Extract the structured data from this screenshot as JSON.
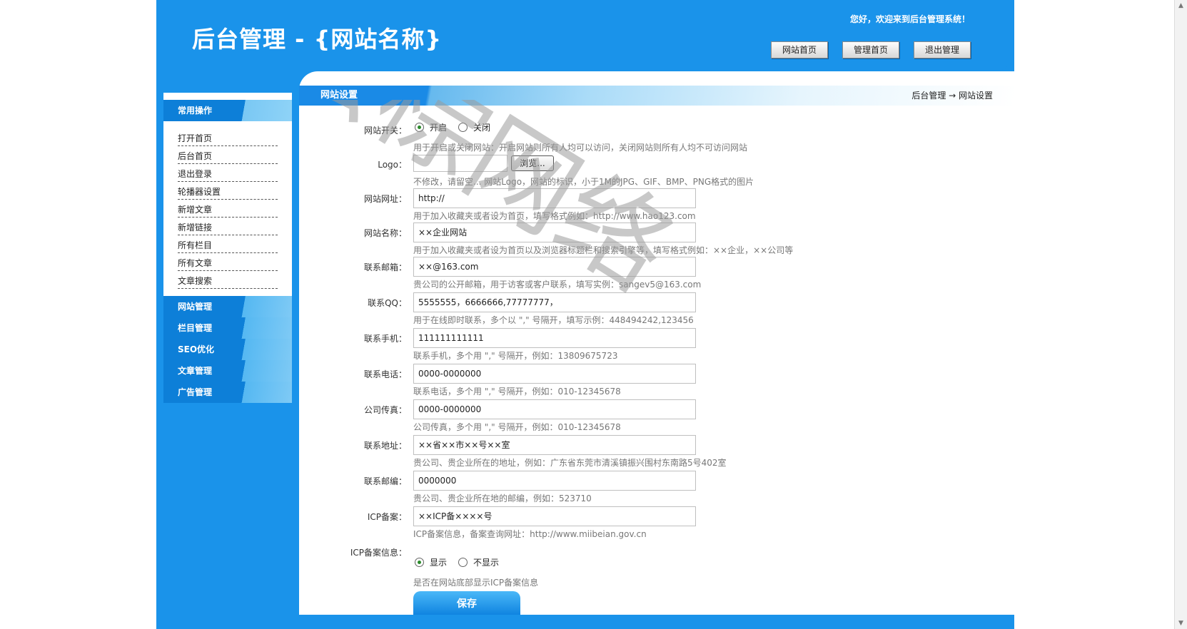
{
  "header": {
    "site_title": "后台管理 - {网站名称}",
    "welcome": "您好，欢迎来到后台管理系统！",
    "buttons": {
      "home": "网站首页",
      "admin": "管理首页",
      "logout": "退出管理"
    }
  },
  "sidebar": {
    "common_title": "常用操作",
    "items": [
      "打开首页",
      "后台首页",
      "退出登录",
      "轮播器设置",
      "新增文章",
      "新增链接",
      "所有栏目",
      "所有文章",
      "文章搜索"
    ],
    "categories": [
      "网站管理",
      "栏目管理",
      "SEO优化",
      "文章管理",
      "广告管理"
    ]
  },
  "content": {
    "title": "网站设置",
    "breadcrumb": "后台管理 → 网站设置"
  },
  "form": {
    "site_switch": {
      "label": "网站开关：",
      "options": [
        "开启",
        "关闭"
      ],
      "selected": "开启",
      "hint": "用于开启或关闭网站：开启网站则所有人均可以访问，关闭网站则所有人均不可访问网站"
    },
    "logo": {
      "label": "Logo：",
      "browse": "浏览...",
      "hint": "不修改，请留空...  网站Logo，网站的标识，小于1M的JPG、GIF、BMP、PNG格式的图片"
    },
    "site_url": {
      "label": "网站网址：",
      "value": "http://",
      "hint": "用于加入收藏夹或者设为首页，填写格式例如：http://www.hao123.com"
    },
    "site_name": {
      "label": "网站名称：",
      "value": "××企业网站",
      "hint": "用于加入收藏夹或者设为首页以及浏览器标题栏和搜索引擎等，填写格式例如：××企业，××公司等"
    },
    "email": {
      "label": "联系邮箱：",
      "value": "××@163.com",
      "hint": "贵公司的公开邮箱，用于访客或客户联系，填写实例：sangev5@163.com"
    },
    "qq": {
      "label": "联系QQ：",
      "value": "5555555，6666666,77777777，",
      "hint": "用于在线即时联系，多个以 \",\" 号隔开，填写示例：448494242,123456"
    },
    "mobile": {
      "label": "联系手机：",
      "value": "111111111111",
      "hint": "联系手机，多个用 \",\" 号隔开，例如：13809675723"
    },
    "phone": {
      "label": "联系电话：",
      "value": "0000-0000000",
      "hint": "联系电话，多个用 \",\" 号隔开，例如：010-12345678"
    },
    "fax": {
      "label": "公司传真：",
      "value": "0000-0000000",
      "hint": "公司传真，多个用 \",\" 号隔开，例如：010-12345678"
    },
    "address": {
      "label": "联系地址：",
      "value": "××省××市××号××室",
      "hint": "贵公司、贵企业所在的地址，例如：广东省东莞市清溪镇振兴围村东南路5号402室"
    },
    "postcode": {
      "label": "联系邮编：",
      "value": "0000000",
      "hint": "贵公司、贵企业所在地的邮编，例如：523710"
    },
    "icp": {
      "label": "ICP备案：",
      "value": "××ICP备××××号",
      "hint": "ICP备案信息，备案查询网址：http://www.miibeian.gov.cn"
    },
    "icp_show": {
      "label": "ICP备案信息：",
      "options": [
        "显示",
        "不显示"
      ],
      "selected": "显示",
      "hint": "是否在网站底部显示ICP备案信息"
    },
    "save": "保存"
  },
  "watermark": "云棕网络",
  "icons": {
    "scroll_up": "scroll-up-arrow-icon",
    "scroll_down": "scroll-down-arrow-icon",
    "radio": "radio-icon"
  },
  "colors": {
    "primary_blue": "#1a93ea",
    "dark_blue": "#0d7fd8",
    "watermark_gray": "#9a9a9a"
  }
}
